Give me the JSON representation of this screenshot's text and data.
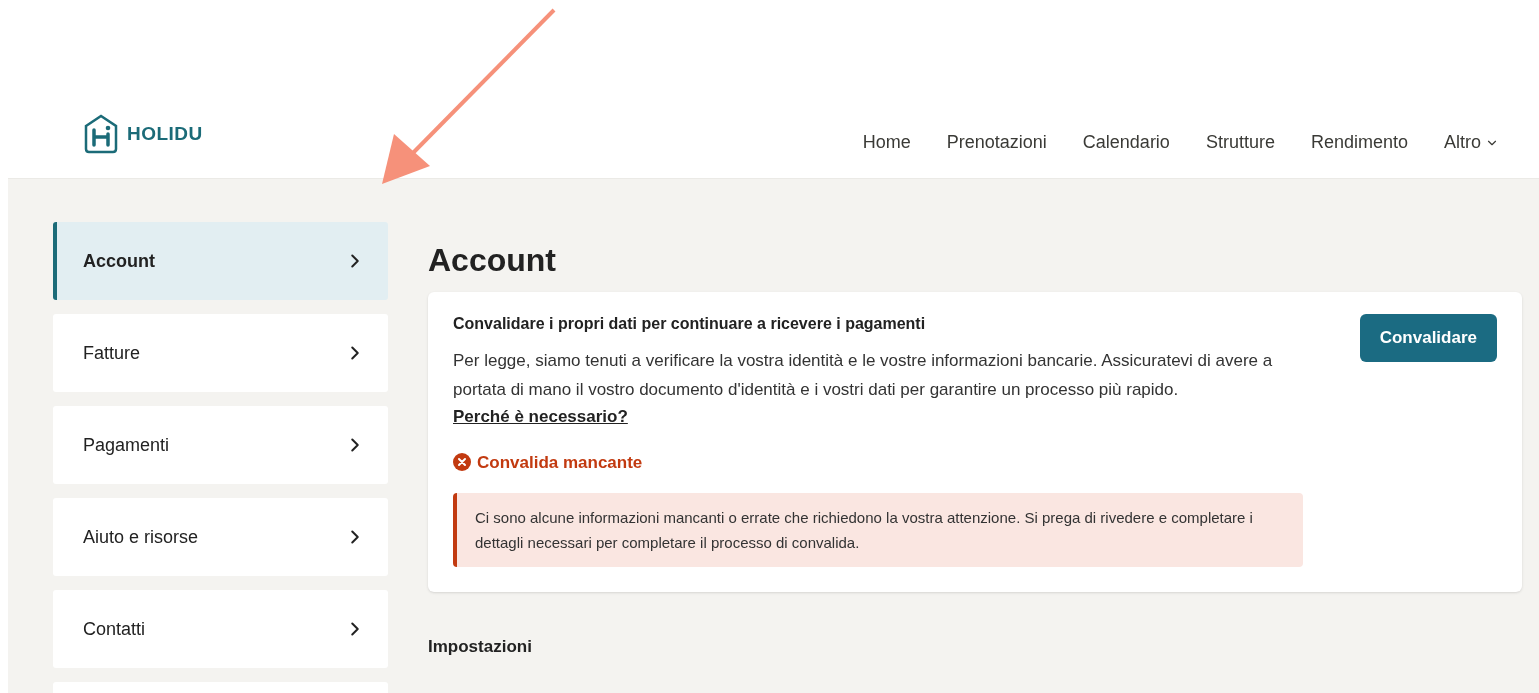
{
  "header": {
    "logo": "HOLIDU",
    "nav": [
      {
        "label": "Home",
        "dropdown": false
      },
      {
        "label": "Prenotazioni",
        "dropdown": false
      },
      {
        "label": "Calendario",
        "dropdown": false
      },
      {
        "label": "Strutture",
        "dropdown": false
      },
      {
        "label": "Rendimento",
        "dropdown": false
      },
      {
        "label": "Altro",
        "dropdown": true
      }
    ]
  },
  "sidebar": {
    "items": [
      {
        "label": "Account",
        "selected": true
      },
      {
        "label": "Fatture",
        "selected": false
      },
      {
        "label": "Pagamenti",
        "selected": false
      },
      {
        "label": "Aiuto e risorse",
        "selected": false
      },
      {
        "label": "Contatti",
        "selected": false
      }
    ]
  },
  "page_title": "Account",
  "verification_card": {
    "title": "Convalidare i propri dati per continuare a ricevere i pagamenti",
    "body": "Per legge, siamo tenuti a verificare la vostra identità e le vostre informazioni bancarie. Assicuratevi di avere a portata di mano il vostro documento d'identità e i vostri dati per garantire un processo più rapido.",
    "link": "Perché è necessario?",
    "status": "Convalida mancante",
    "alert": "Ci sono alcune informazioni mancanti o errate che richiedono la vostra attenzione. Si prega di rivedere e completare i dettagli necessari per completare il processo di convalida.",
    "button": "Convalidare"
  },
  "section_title": "Impostazioni"
}
